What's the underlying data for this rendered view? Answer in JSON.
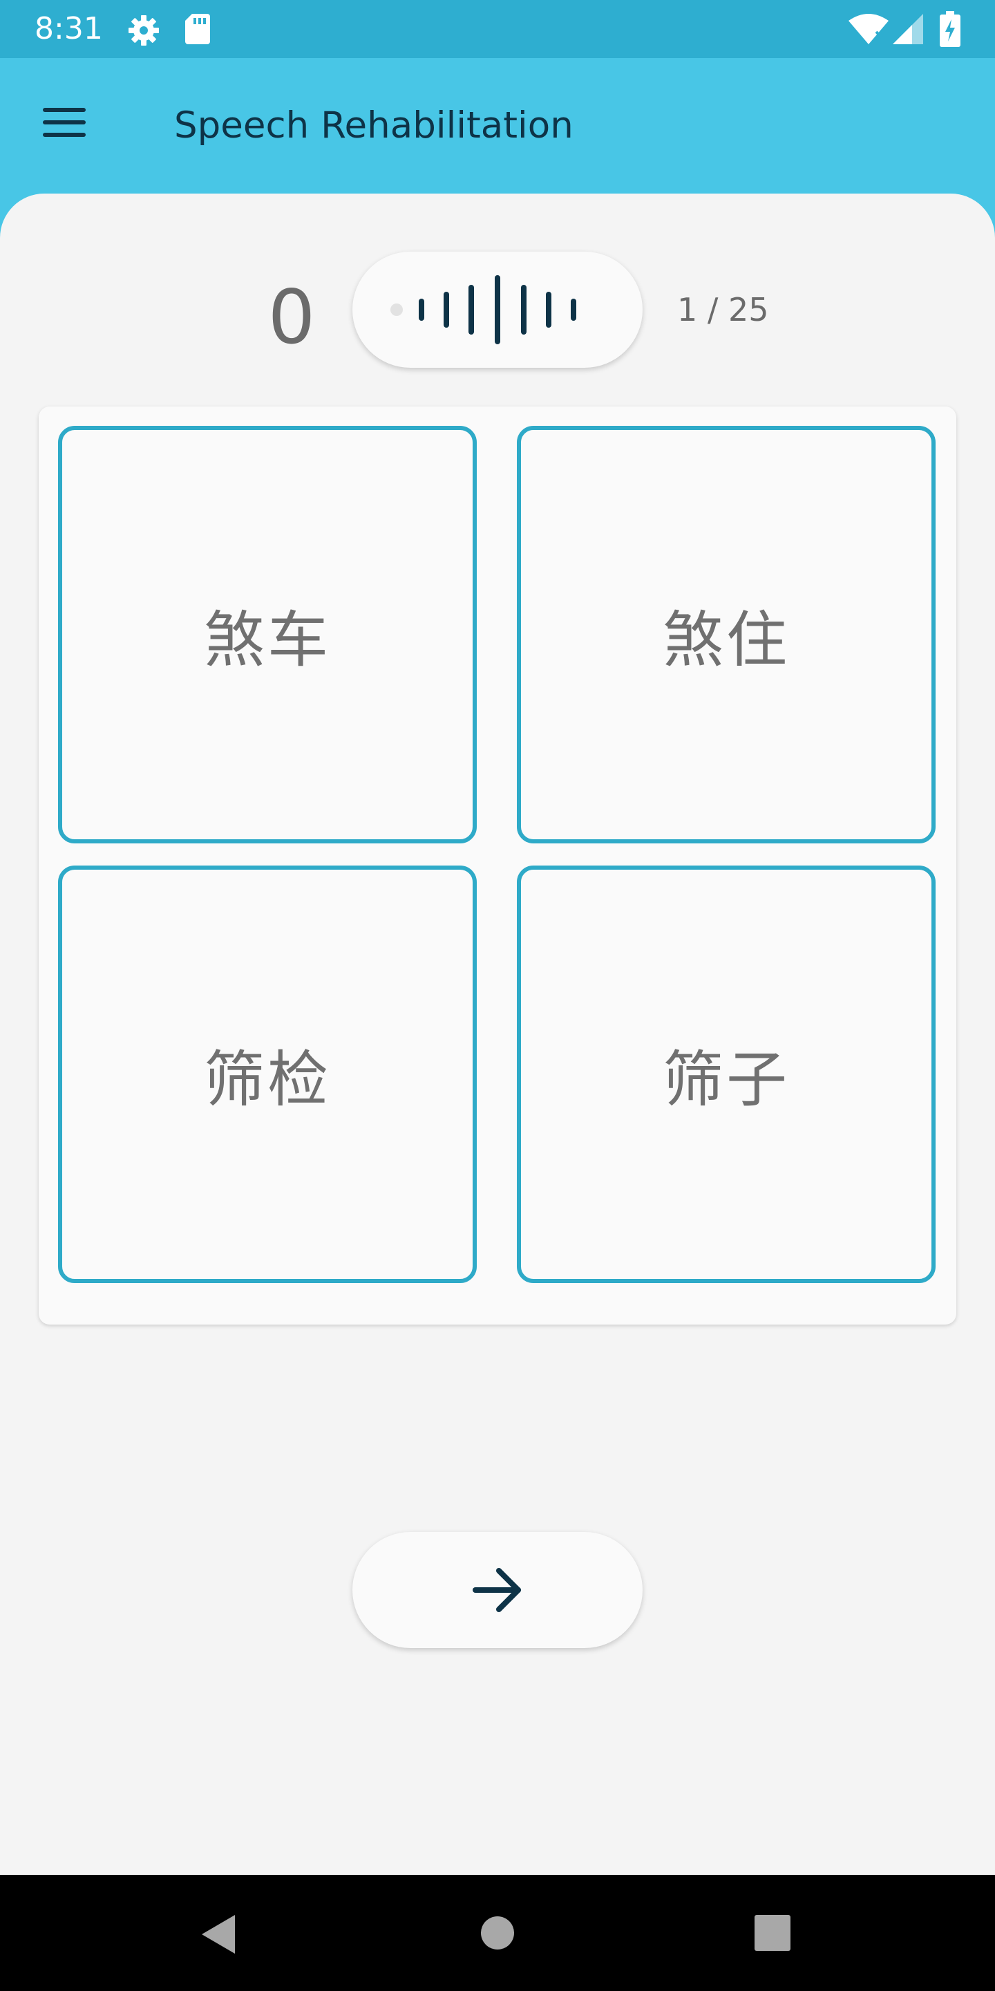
{
  "status_bar": {
    "time": "8:31",
    "icons": [
      "settings-icon",
      "sd-card-icon",
      "wifi-icon",
      "signal-icon",
      "battery-charging-icon"
    ]
  },
  "app_bar": {
    "title": "Speech Rehabilitation",
    "menu_icon": "menu-icon"
  },
  "quiz": {
    "score": "0",
    "progress": "1 / 25",
    "voice_icon": "audio-waveform-icon",
    "options": [
      "煞车",
      "煞住",
      "筛检",
      "筛子"
    ],
    "next_icon": "arrow-right-icon"
  },
  "nav_bar": {
    "icons": [
      "back-icon",
      "home-icon",
      "recents-icon"
    ]
  },
  "colors": {
    "status_bar": "#2eaed0",
    "app_bar": "#48c6e6",
    "accent_border": "#2eaac8",
    "title_text": "#0e3347",
    "background": "#f4f4f4"
  }
}
